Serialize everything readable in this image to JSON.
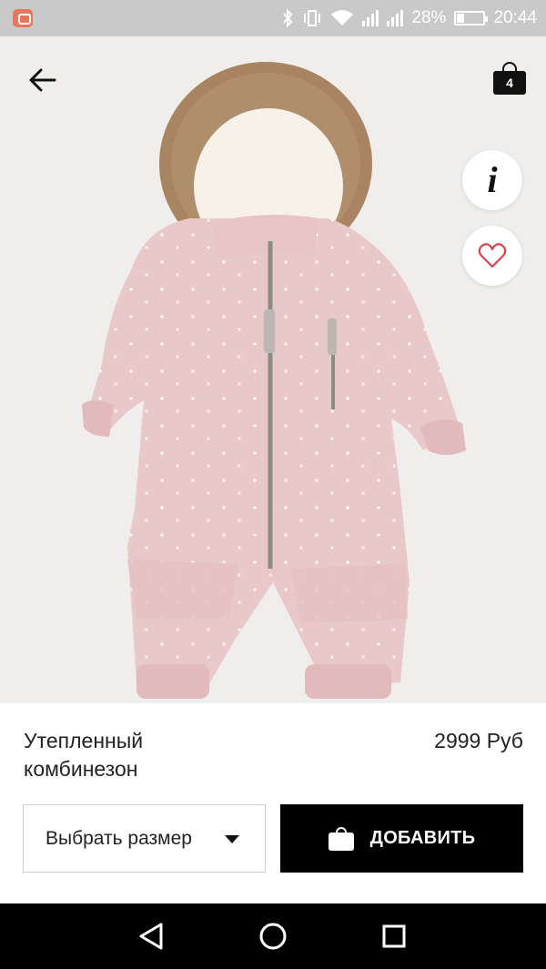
{
  "status_bar": {
    "battery_percent": "28%",
    "battery_level": 0.28,
    "time": "20:44",
    "icons": [
      "notification-app-icon",
      "bluetooth-icon",
      "vibrate-icon",
      "wifi-icon",
      "signal-icon",
      "signal-icon",
      "battery-icon"
    ]
  },
  "header": {
    "back_icon": "arrow-left-icon",
    "cart_icon": "shopping-bag-icon",
    "cart_count": "4"
  },
  "product_image": {
    "alt": "Утепленный комбинезон",
    "colors": {
      "background": "#efeeec",
      "suit": "#e9c8c9",
      "fur": "#a88462",
      "lining": "#f6f2ea",
      "zipper": "#8e8a86"
    }
  },
  "actions": {
    "info_icon": "info-icon",
    "info_label": "i",
    "favorite_icon": "heart-outline-icon",
    "favorite_color": "#d2444e"
  },
  "product": {
    "title": "Утепленный комбинезон",
    "price": "2999 Руб"
  },
  "size_select": {
    "label": "Выбрать размер",
    "icon": "caret-down-icon"
  },
  "add_button": {
    "label": "ДОБАВИТЬ",
    "icon": "shopping-bag-icon"
  },
  "nav": {
    "back_icon": "triangle-back-icon",
    "home_icon": "circle-home-icon",
    "recents_icon": "square-recents-icon"
  }
}
